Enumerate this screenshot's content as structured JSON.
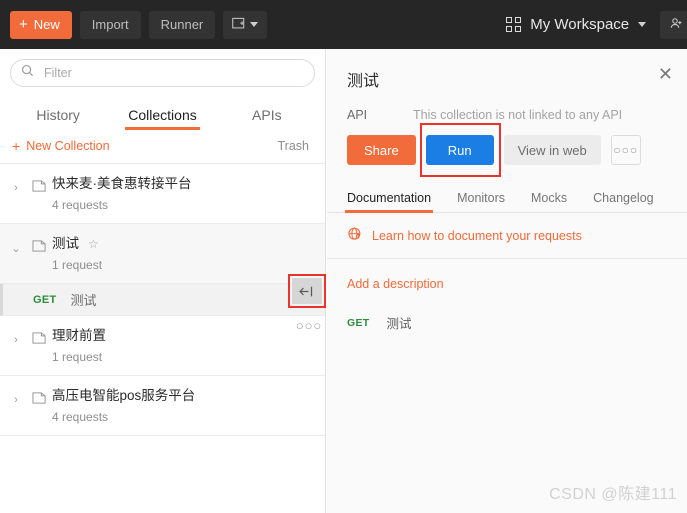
{
  "topbar": {
    "new_button": "New",
    "new_plus": "+",
    "import_button": "Import",
    "runner_button": "Runner",
    "new_window_caret": "⌄",
    "workspace_label": "My Workspace",
    "invite_label": "In"
  },
  "sidebar": {
    "search": {
      "placeholder": "Filter",
      "value": ""
    },
    "tabs": [
      {
        "label": "History",
        "active": false
      },
      {
        "label": "Collections",
        "active": true
      },
      {
        "label": "APIs",
        "active": false
      }
    ],
    "new_collection": "New Collection",
    "new_collection_plus": "+",
    "trash": "Trash",
    "collections": [
      {
        "name": "快来麦·美食惠转接平台",
        "count": "4 requests",
        "expanded": false,
        "chevron": "›",
        "starred": false
      },
      {
        "name": "测试",
        "count": "1 request",
        "expanded": true,
        "chevron": "⌄",
        "starred": true,
        "star": "☆"
      },
      {
        "name": "理财前置",
        "count": "1 request",
        "expanded": false,
        "chevron": "›",
        "starred": false
      },
      {
        "name": "高压电智能pos服务平台",
        "count": "4 requests",
        "expanded": false,
        "chevron": "›",
        "starred": false
      }
    ],
    "request_row": {
      "method": "GET",
      "name": "测试"
    },
    "collapse_icon": "←|",
    "more_icon": "○○○"
  },
  "panel": {
    "title": "测试",
    "close_icon": "✕",
    "api_label": "API",
    "api_value": "This collection is not linked to any API",
    "share_button": "Share",
    "run_button": "Run",
    "view_button": "View in web",
    "more_button": "○○○",
    "tabs": [
      {
        "label": "Documentation",
        "active": true
      },
      {
        "label": "Monitors",
        "active": false
      },
      {
        "label": "Mocks",
        "active": false
      },
      {
        "label": "Changelog",
        "active": false
      }
    ],
    "learn_link": "Learn how to document your requests",
    "add_description": "Add a description",
    "request": {
      "method": "GET",
      "name": "测试"
    }
  },
  "watermark": "CSDN @陈建111",
  "colors": {
    "orange": "#f26b3a",
    "blue": "#1a7ee5",
    "green": "#2e8b3d",
    "highlight_red": "#e8342a",
    "topbar_bg": "#262626"
  }
}
